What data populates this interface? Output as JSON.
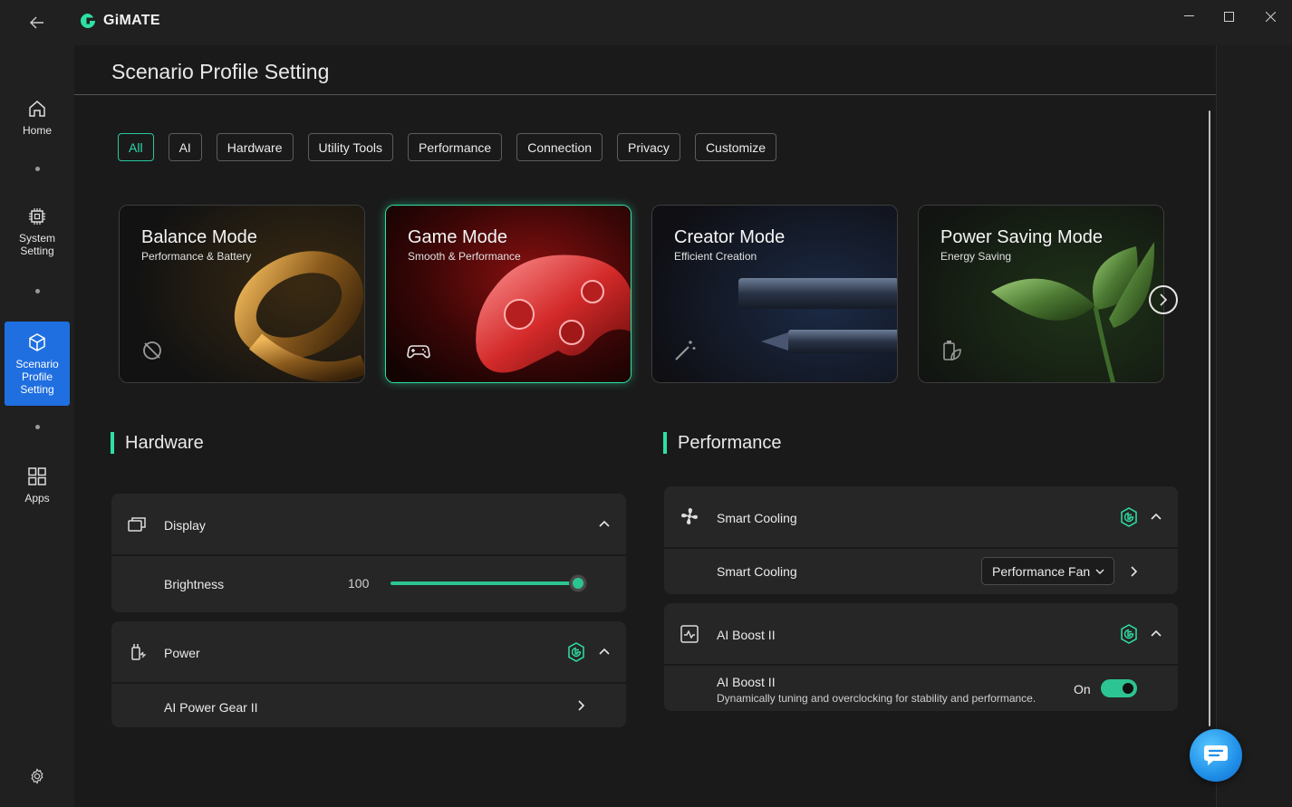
{
  "app": {
    "name": "GiMATE"
  },
  "sidebar": {
    "items": [
      {
        "label": "Home"
      },
      {
        "label": "System Setting"
      },
      {
        "label": "Scenario Profile Setting"
      },
      {
        "label": "Apps"
      }
    ],
    "active": "Scenario Profile Setting"
  },
  "page": {
    "title": "Scenario Profile Setting"
  },
  "filters": [
    "All",
    "AI",
    "Hardware",
    "Utility Tools",
    "Performance",
    "Connection",
    "Privacy",
    "Customize"
  ],
  "filter_active": "All",
  "modes": [
    {
      "title": "Balance Mode",
      "subtitle": "Performance & Battery",
      "icon": "balance-icon"
    },
    {
      "title": "Game Mode",
      "subtitle": "Smooth & Performance",
      "icon": "gamepad-icon"
    },
    {
      "title": "Creator Mode",
      "subtitle": "Efficient Creation",
      "icon": "magic-wand-icon"
    },
    {
      "title": "Power Saving Mode",
      "subtitle": "Energy Saving",
      "icon": "eco-battery-icon"
    }
  ],
  "selected_mode": "Game Mode",
  "hardware": {
    "heading": "Hardware",
    "display": {
      "label": "Display",
      "brightness_label": "Brightness",
      "brightness_value": "100",
      "brightness_level": 100
    },
    "power": {
      "label": "Power",
      "ai_power_gear": "AI Power Gear II"
    }
  },
  "performance": {
    "heading": "Performance",
    "smart_cooling": {
      "label": "Smart Cooling",
      "row_label": "Smart Cooling",
      "selected": "Performance Fan"
    },
    "ai_boost": {
      "label": "AI Boost II",
      "row_label": "AI Boost II",
      "description": "Dynamically tuning and overclocking for stability and performance.",
      "state": "On"
    }
  },
  "colors": {
    "accent": "#2ee0a5",
    "active_nav": "#1f6fe0"
  }
}
